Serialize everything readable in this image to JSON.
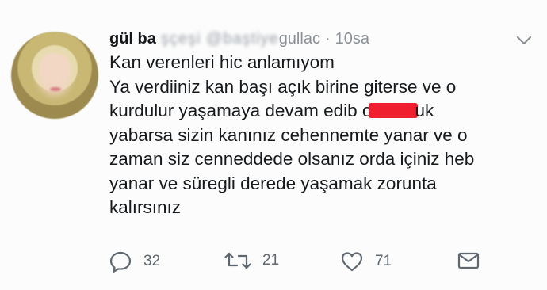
{
  "tweet": {
    "author_name": "gül ba",
    "author_handle_blurred": "şçeşi @baştiye",
    "author_handle_tail": "gullac",
    "time": "10sa",
    "lines": [
      "Kan verenleri hic anlamıyom",
      "Ya verdiiniz kan başı açık birine giterse ve o",
      "kurdulur yaşamaya devam edib o",
      "yabarsa sizin kanınız cehennemte yanar ve o",
      "zaman siz cenneddede olsanız orda içiniz heb",
      "yanar ve süregli derede yaşamak zorunta",
      "kalırsınız"
    ],
    "line3_after_redaction": "uk",
    "redaction_color": "#ef1f2f",
    "replies": "32",
    "retweets": "21",
    "likes": "71"
  },
  "icons": {
    "menu": "chevron-down-icon",
    "reply": "reply-icon",
    "retweet": "retweet-icon",
    "like": "heart-icon",
    "share": "mail-icon"
  }
}
